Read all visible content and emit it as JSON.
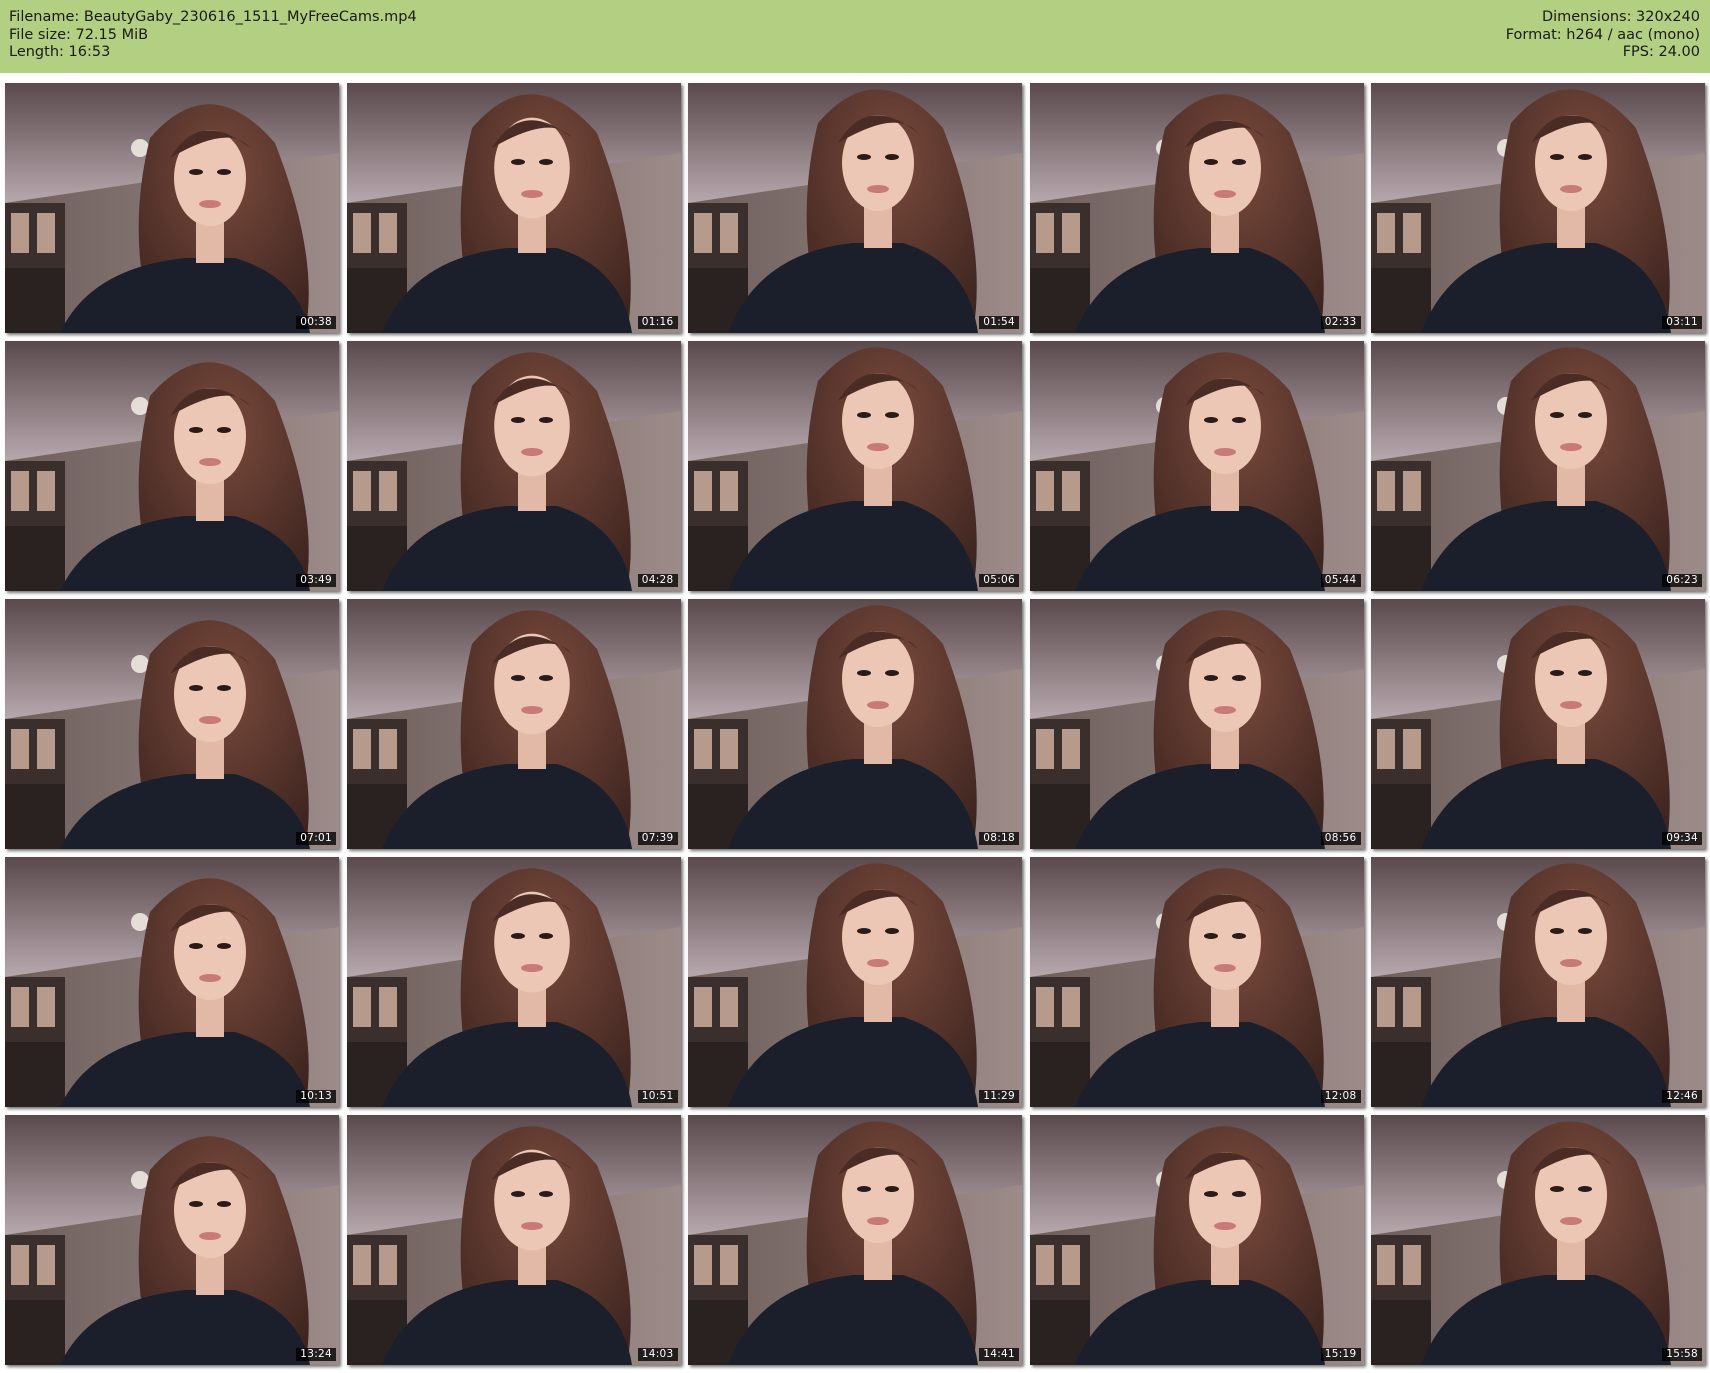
{
  "header": {
    "filename_line": "Filename: BeautyGaby_230616_1511_MyFreeCams.mp4",
    "filesize_line": "File size: 72.15 MiB",
    "length_line": "Length: 16:53",
    "dimensions_line": "Dimensions: 320x240",
    "format_line": "Format: h264 / aac (mono)",
    "fps_line": "FPS: 24.00"
  },
  "colors": {
    "header_background": "#b3cf81",
    "page_background": "#ffffff",
    "timestamp_background": "#000000",
    "timestamp_text": "#ffffff"
  },
  "thumbnails": [
    {
      "time": "00:38"
    },
    {
      "time": "01:16"
    },
    {
      "time": "01:54"
    },
    {
      "time": "02:33"
    },
    {
      "time": "03:11"
    },
    {
      "time": "03:49"
    },
    {
      "time": "04:28"
    },
    {
      "time": "05:06"
    },
    {
      "time": "05:44"
    },
    {
      "time": "06:23"
    },
    {
      "time": "07:01"
    },
    {
      "time": "07:39"
    },
    {
      "time": "08:18"
    },
    {
      "time": "08:56"
    },
    {
      "time": "09:34"
    },
    {
      "time": "10:13"
    },
    {
      "time": "10:51"
    },
    {
      "time": "11:29"
    },
    {
      "time": "12:08"
    },
    {
      "time": "12:46"
    },
    {
      "time": "13:24"
    },
    {
      "time": "14:03"
    },
    {
      "time": "14:41"
    },
    {
      "time": "15:19"
    },
    {
      "time": "15:58"
    }
  ]
}
